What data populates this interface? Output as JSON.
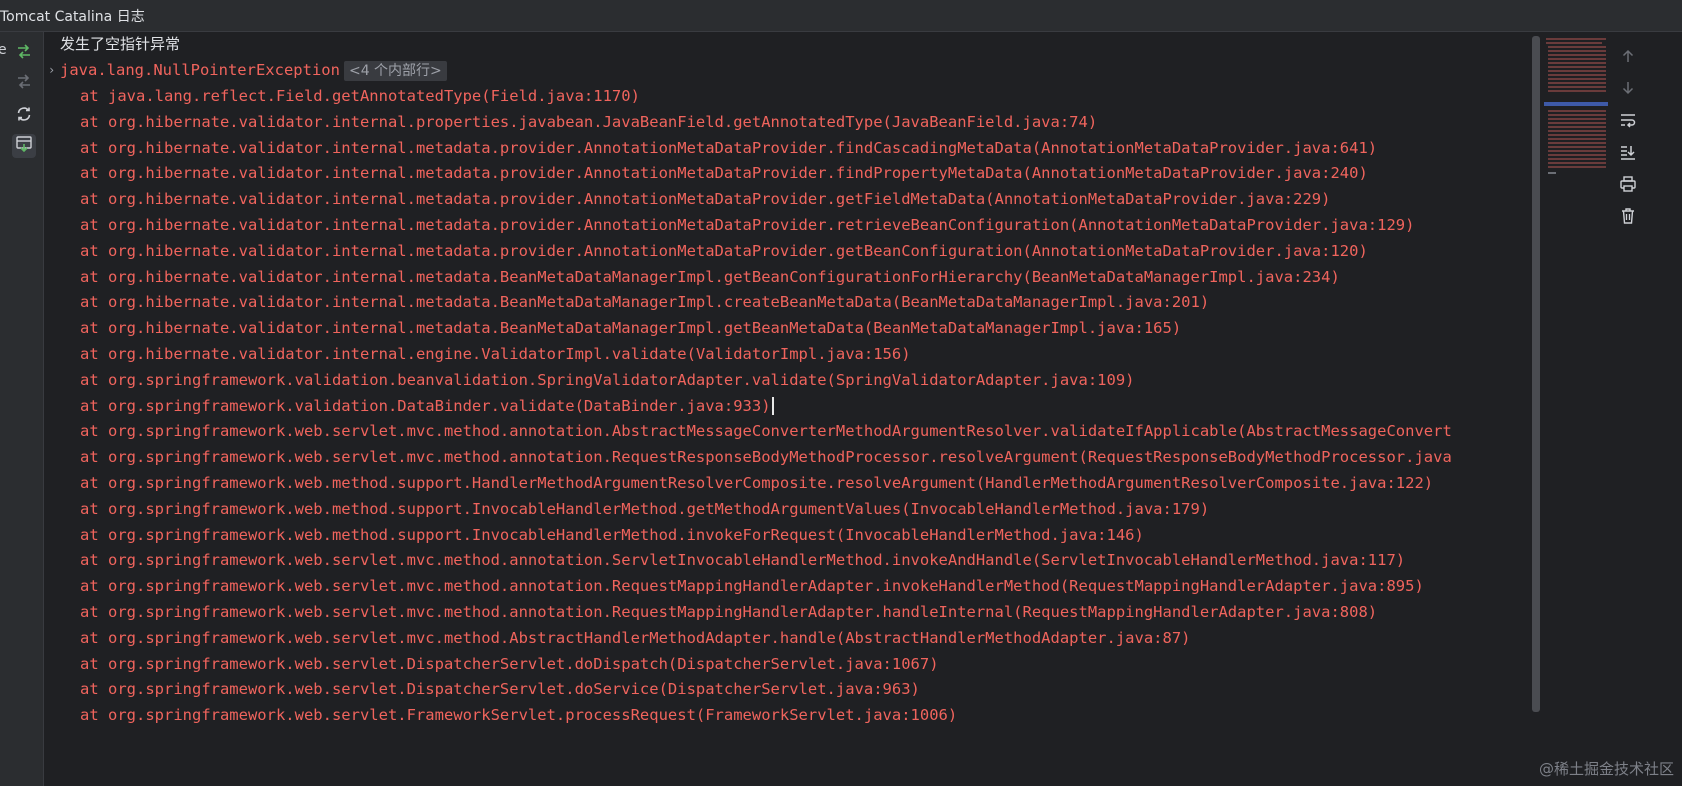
{
  "window": {
    "title": "Tomcat Catalina 日志",
    "left_edge_text": "e"
  },
  "toolbar": {
    "left": [
      {
        "icon": "restore-layout-icon"
      },
      {
        "icon": "soft-wrap-disabled-icon"
      },
      {
        "icon": "rerun-icon"
      },
      {
        "icon": "console-filter-icon"
      }
    ],
    "right": [
      {
        "icon": "arrow-up-icon"
      },
      {
        "icon": "arrow-down-icon"
      },
      {
        "icon": "soft-wrap-icon"
      },
      {
        "icon": "scroll-to-end-icon"
      },
      {
        "icon": "print-icon"
      },
      {
        "icon": "trash-icon"
      }
    ]
  },
  "console": {
    "info_line": "发生了空指针异常",
    "exception": "java.lang.NullPointerException",
    "internal_hint": "<4 个内部行>",
    "frames": [
      "at java.lang.reflect.Field.getAnnotatedType(Field.java:1170)",
      "at org.hibernate.validator.internal.properties.javabean.JavaBeanField.getAnnotatedType(JavaBeanField.java:74)",
      "at org.hibernate.validator.internal.metadata.provider.AnnotationMetaDataProvider.findCascadingMetaData(AnnotationMetaDataProvider.java:641)",
      "at org.hibernate.validator.internal.metadata.provider.AnnotationMetaDataProvider.findPropertyMetaData(AnnotationMetaDataProvider.java:240)",
      "at org.hibernate.validator.internal.metadata.provider.AnnotationMetaDataProvider.getFieldMetaData(AnnotationMetaDataProvider.java:229)",
      "at org.hibernate.validator.internal.metadata.provider.AnnotationMetaDataProvider.retrieveBeanConfiguration(AnnotationMetaDataProvider.java:129)",
      "at org.hibernate.validator.internal.metadata.provider.AnnotationMetaDataProvider.getBeanConfiguration(AnnotationMetaDataProvider.java:120)",
      "at org.hibernate.validator.internal.metadata.BeanMetaDataManagerImpl.getBeanConfigurationForHierarchy(BeanMetaDataManagerImpl.java:234)",
      "at org.hibernate.validator.internal.metadata.BeanMetaDataManagerImpl.createBeanMetaData(BeanMetaDataManagerImpl.java:201)",
      "at org.hibernate.validator.internal.metadata.BeanMetaDataManagerImpl.getBeanMetaData(BeanMetaDataManagerImpl.java:165)",
      "at org.hibernate.validator.internal.engine.ValidatorImpl.validate(ValidatorImpl.java:156)",
      "at org.springframework.validation.beanvalidation.SpringValidatorAdapter.validate(SpringValidatorAdapter.java:109)",
      "at org.springframework.validation.DataBinder.validate(DataBinder.java:933)",
      "at org.springframework.web.servlet.mvc.method.annotation.AbstractMessageConverterMethodArgumentResolver.validateIfApplicable(AbstractMessageConvert",
      "at org.springframework.web.servlet.mvc.method.annotation.RequestResponseBodyMethodProcessor.resolveArgument(RequestResponseBodyMethodProcessor.java",
      "at org.springframework.web.method.support.HandlerMethodArgumentResolverComposite.resolveArgument(HandlerMethodArgumentResolverComposite.java:122)",
      "at org.springframework.web.method.support.InvocableHandlerMethod.getMethodArgumentValues(InvocableHandlerMethod.java:179)",
      "at org.springframework.web.method.support.InvocableHandlerMethod.invokeForRequest(InvocableHandlerMethod.java:146)",
      "at org.springframework.web.servlet.mvc.method.annotation.ServletInvocableHandlerMethod.invokeAndHandle(ServletInvocableHandlerMethod.java:117)",
      "at org.springframework.web.servlet.mvc.method.annotation.RequestMappingHandlerAdapter.invokeHandlerMethod(RequestMappingHandlerAdapter.java:895)",
      "at org.springframework.web.servlet.mvc.method.annotation.RequestMappingHandlerAdapter.handleInternal(RequestMappingHandlerAdapter.java:808)",
      "at org.springframework.web.servlet.mvc.method.AbstractHandlerMethodAdapter.handle(AbstractHandlerMethodAdapter.java:87)",
      "at org.springframework.web.servlet.DispatcherServlet.doDispatch(DispatcherServlet.java:1067)",
      "at org.springframework.web.servlet.DispatcherServlet.doService(DispatcherServlet.java:963)",
      "at org.springframework.web.servlet.FrameworkServlet.processRequest(FrameworkServlet.java:1006)"
    ]
  },
  "colors": {
    "background": "#1f2023",
    "error_text": "#f0645d",
    "info_text": "#dfe1e5"
  },
  "watermark": "@稀土掘金技术社区"
}
